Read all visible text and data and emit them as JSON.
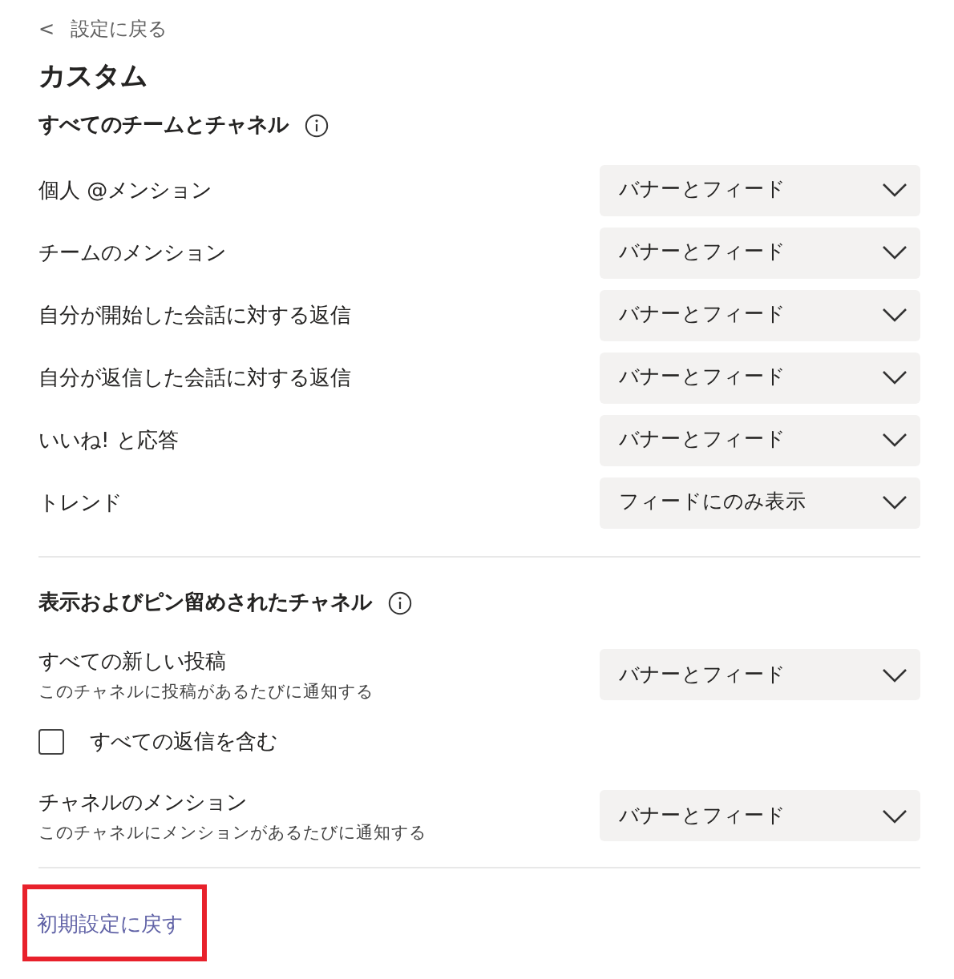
{
  "back_link": {
    "icon": "<",
    "label": "設定に戻る"
  },
  "title": "カスタム",
  "sections": [
    {
      "heading": "すべてのチームとチャネル",
      "info": true,
      "items": [
        {
          "kind": "dropdown",
          "label": "個人 @メンション",
          "value": "バナーとフィード"
        },
        {
          "kind": "dropdown",
          "label": "チームのメンション",
          "value": "バナーとフィード"
        },
        {
          "kind": "dropdown",
          "label": "自分が開始した会話に対する返信",
          "value": "バナーとフィード"
        },
        {
          "kind": "dropdown",
          "label": "自分が返信した会話に対する返信",
          "value": "バナーとフィード"
        },
        {
          "kind": "dropdown",
          "label": "いいね! と応答",
          "value": "バナーとフィード"
        },
        {
          "kind": "dropdown",
          "label": "トレンド",
          "value": "フィードにのみ表示"
        }
      ]
    },
    {
      "heading": "表示およびピン留めされたチャネル",
      "info": true,
      "items": [
        {
          "kind": "dropdown",
          "label": "すべての新しい投稿",
          "description": "このチャネルに投稿があるたびに通知する",
          "value": "バナーとフィード"
        },
        {
          "kind": "checkbox",
          "label": "すべての返信を含む",
          "checked": false
        },
        {
          "kind": "dropdown",
          "label": "チャネルのメンション",
          "description": "このチャネルにメンションがあるたびに通知する",
          "value": "バナーとフィード"
        }
      ]
    }
  ],
  "reset_link": {
    "label": "初期設定に戻す",
    "highlighted": true
  }
}
